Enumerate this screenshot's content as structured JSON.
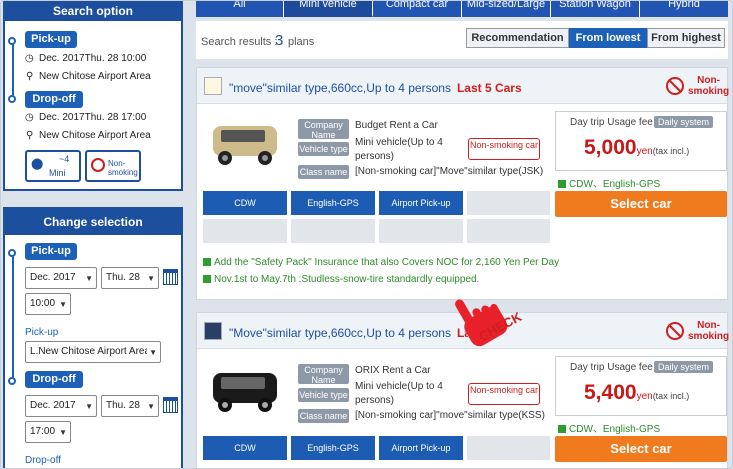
{
  "sidebar": {
    "search_option_title": "Search option",
    "pickup_label": "Pick-up",
    "pickup_datetime": "Dec. 2017Thu. 28 10:00",
    "pickup_location": "New Chitose Airport Area",
    "dropoff_label": "Drop-off",
    "dropoff_datetime": "Dec. 2017Thu. 28 17:00",
    "dropoff_location": "New Chitose Airport Area",
    "filter_mini_label": "Mini",
    "filter_mini_cap": "~4",
    "filter_nonsmoking_label": "Non-smoking",
    "change_selection_title": "Change selection",
    "cs_pickup_label": "Pick-up",
    "cs_pickup_month": "Dec. 2017",
    "cs_pickup_day": "Thu. 28",
    "cs_pickup_time": "10:00",
    "cs_pickup_place_label": "Pick-up",
    "cs_pickup_place": "L.New Chitose Airport Area",
    "cs_dropoff_label": "Drop-off",
    "cs_dropoff_month": "Dec. 2017",
    "cs_dropoff_day": "Thu. 28",
    "cs_dropoff_time": "17:00",
    "cs_dropoff_place_label": "Drop-off"
  },
  "tabs": [
    {
      "label": "All"
    },
    {
      "label": "Mini vehicle"
    },
    {
      "label": "Compact car"
    },
    {
      "label": "Mid-sized/Large"
    },
    {
      "label": "Station Wagon"
    },
    {
      "label": "Hybrid"
    }
  ],
  "results": {
    "label": "Search results :",
    "count": "3",
    "unit": "plans",
    "sort_recommendation": "Recommendation",
    "sort_lowest": "From lowest",
    "sort_highest": "From highest"
  },
  "cards": [
    {
      "title": "\"move\"similar type,660cc,Up to 4 persons",
      "badge": "Last 5 Cars",
      "nonsmoking_icon_label": "Non-smoking",
      "company_label": "Company Name",
      "company": "Budget Rent a Car",
      "vehicle_label": "Vehicle type",
      "vehicle": "Mini vehicle(Up to 4 persons)",
      "class_label": "Class name",
      "class": "[Non-smoking car]\"Move\"similar type(JSK)",
      "nonsmoking_badge": "Non-smoking car",
      "fee_label": "Day trip Usage fee",
      "daily_label": "Daily system",
      "price": "5,000",
      "price_unit": "yen",
      "price_tax": "(tax incl.)",
      "included": "CDW、English-GPS",
      "select_label": "Select car",
      "options": [
        "CDW",
        "English-GPS",
        "Airport Pick-up"
      ],
      "notes": [
        "Add the \"Safety Pack\" Insurance that also Covers NOC for 2,160 Yen Per Day",
        "Nov.1st to May.7th :Studless-snow-tire standardly equipped."
      ]
    },
    {
      "title": "\"Move\"similar type,660cc,Up to 4 persons",
      "badge": "La",
      "nonsmoking_icon_label": "Non-smoking",
      "company_label": "Company Name",
      "company": "ORIX Rent a Car",
      "vehicle_label": "Vehicle type",
      "vehicle": "Mini vehicle(Up to 4 persons)",
      "class_label": "Class name",
      "class": "[Non-smoking car]\"move\"similar type(KSS)",
      "nonsmoking_badge": "Non-smoking car",
      "fee_label": "Day trip Usage fee",
      "daily_label": "Daily system",
      "price": "5,400",
      "price_unit": "yen",
      "price_tax": "(tax incl.)",
      "included": "CDW、English-GPS",
      "select_label": "Select car",
      "options": [
        "CDW",
        "English-GPS",
        "Airport Pick-up"
      ]
    }
  ],
  "check_overlay": "CHECK",
  "colors": {
    "primary_blue": "#1d4f9f",
    "accent_orange": "#f07a1e",
    "price_red": "#c81818",
    "note_green": "#2e8b2e"
  }
}
